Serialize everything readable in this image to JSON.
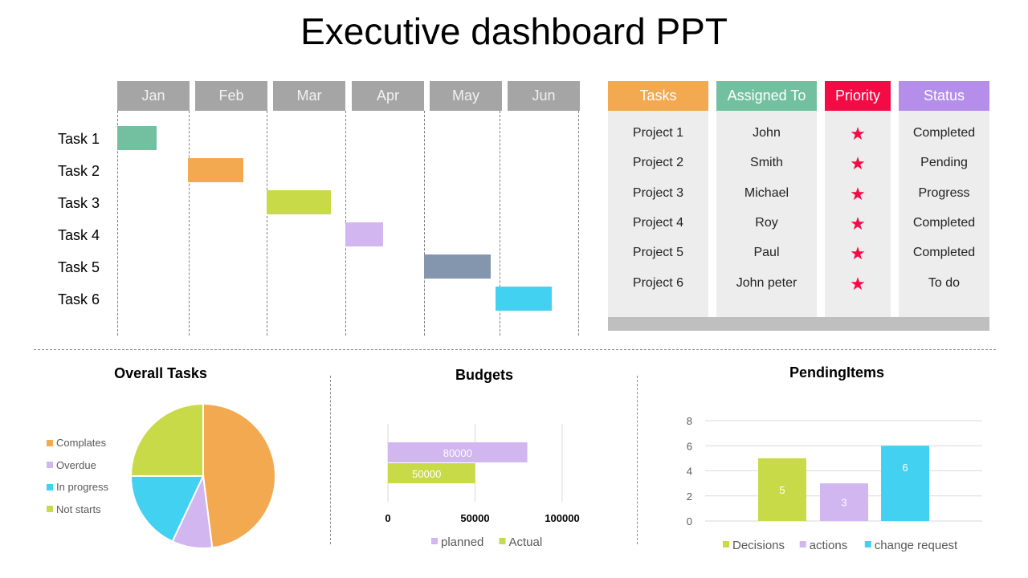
{
  "page": {
    "title": "Executive dashboard PPT"
  },
  "colors": {
    "header_gray": "#a5a5a5",
    "task1": "#72c09f",
    "task2": "#f2a950",
    "task3": "#c8da48",
    "task4": "#d1b6ef",
    "task5": "#8396ae",
    "task6": "#42d1f0",
    "tasks_head": "#f2a950",
    "assigned_head": "#72c09f",
    "priority_head": "#f40a45",
    "status_head": "#b48ee9",
    "star": "#f40a45"
  },
  "table": {
    "headers": [
      "Tasks",
      "Assigned To",
      "Priority",
      "Status"
    ],
    "rows": [
      {
        "task": "Project 1",
        "assigned": "John",
        "priority": "★",
        "status": "Completed"
      },
      {
        "task": "Project 2",
        "assigned": "Smith",
        "priority": "★",
        "status": "Pending"
      },
      {
        "task": "Project 3",
        "assigned": "Michael",
        "priority": "★",
        "status": "Progress"
      },
      {
        "task": "Project 4",
        "assigned": "Roy",
        "priority": "★",
        "status": "Completed"
      },
      {
        "task": "Project 5",
        "assigned": "Paul",
        "priority": "★",
        "status": "Completed"
      },
      {
        "task": "Project 6",
        "assigned": "John peter",
        "priority": "★",
        "status": "To do"
      }
    ]
  },
  "chart_data": [
    {
      "type": "bar",
      "subtype": "gantt",
      "title": "",
      "categories": [
        "Jan",
        "Feb",
        "Mar",
        "Apr",
        "May",
        "Jun"
      ],
      "tasks": [
        {
          "name": "Task 1",
          "start": 0.0,
          "end": 0.55,
          "color": "#72c09f"
        },
        {
          "name": "Task 2",
          "start": 0.99,
          "end": 1.7,
          "color": "#f2a950"
        },
        {
          "name": "Task 3",
          "start": 2.0,
          "end": 2.82,
          "color": "#c8da48"
        },
        {
          "name": "Task 4",
          "start": 3.0,
          "end": 3.48,
          "color": "#d1b6ef"
        },
        {
          "name": "Task 5",
          "start": 4.0,
          "end": 4.88,
          "color": "#8396ae"
        },
        {
          "name": "Task 6",
          "start": 4.95,
          "end": 5.66,
          "color": "#42d1f0"
        }
      ]
    },
    {
      "type": "pie",
      "title": "Overall Tasks",
      "legend": "left",
      "slices": [
        {
          "label": "Complates",
          "value": 48,
          "color": "#f2a950"
        },
        {
          "label": "Overdue",
          "value": 9,
          "color": "#d1b6ef"
        },
        {
          "label": "In progress",
          "value": 18,
          "color": "#42d1f0"
        },
        {
          "label": "Not starts",
          "value": 25,
          "color": "#c8da48"
        }
      ]
    },
    {
      "type": "bar",
      "orientation": "horizontal",
      "title": "Budgets",
      "xlim": [
        0,
        100000
      ],
      "xticks": [
        "0",
        "50000",
        "100000"
      ],
      "grid": true,
      "legend": "bottom",
      "series": [
        {
          "name": "planned",
          "values": [
            80000
          ],
          "color": "#d1b6ef",
          "label": "80000"
        },
        {
          "name": "Actual",
          "values": [
            50000
          ],
          "color": "#c8da48",
          "label": "50000"
        }
      ]
    },
    {
      "type": "bar",
      "title": "PendingItems",
      "ylim": [
        0,
        8
      ],
      "yticks": [
        "0",
        "2",
        "4",
        "6",
        "8"
      ],
      "grid": true,
      "legend": "bottom",
      "series": [
        {
          "name": "Decisions",
          "values": [
            5
          ],
          "color": "#c8da48",
          "label": "5"
        },
        {
          "name": "actions",
          "values": [
            3
          ],
          "color": "#d1b6ef",
          "label": "3"
        },
        {
          "name": "change request",
          "values": [
            6
          ],
          "color": "#42d1f0",
          "label": "6"
        }
      ]
    }
  ]
}
